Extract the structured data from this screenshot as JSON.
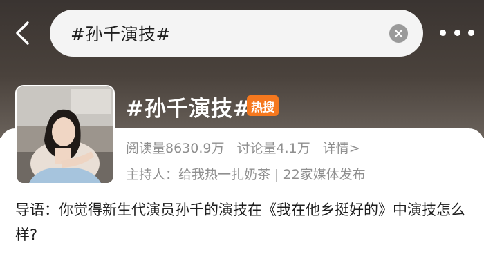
{
  "search": {
    "query": "#孙千演技#"
  },
  "icons": {
    "back": "chevron-left-icon",
    "clear": "close-circle-icon",
    "more": "more-horizontal-icon"
  },
  "topic": {
    "title": "#孙千演技#",
    "badge": "热搜",
    "reads": "阅读量8630.9万",
    "discussions": "讨论量4.1万",
    "details": "详情>",
    "host": "主持人：给我热一扎奶茶 | 22家媒体发布"
  },
  "intro": {
    "text": "导语：你觉得新生代演员孙千的演技在《我在他乡挺好的》中演技怎么样?"
  },
  "colors": {
    "header_bg": "#3a3431",
    "badge": "#f5781e",
    "muted_text": "#8f8f8f"
  }
}
